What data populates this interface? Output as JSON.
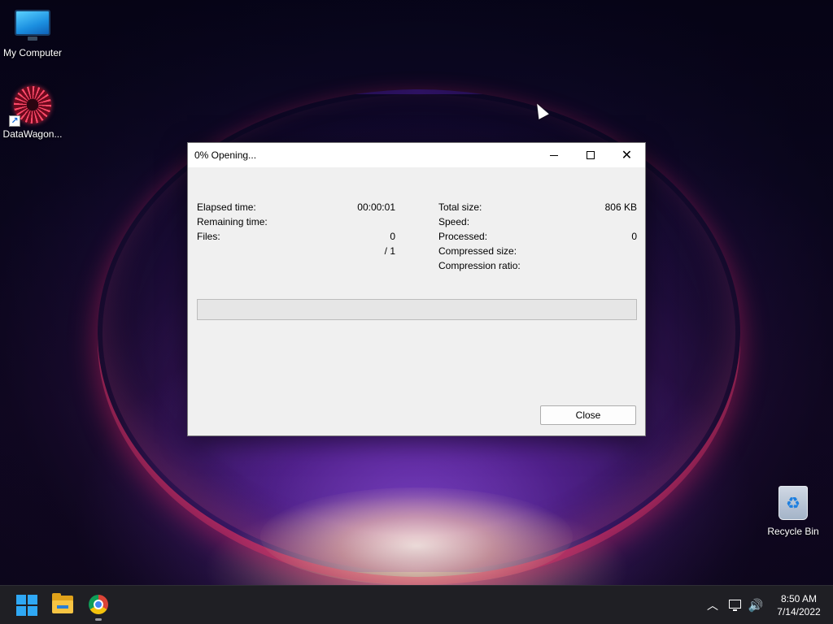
{
  "desktop": {
    "icons": [
      {
        "label": "My Computer"
      },
      {
        "label": "DataWagon..."
      },
      {
        "label": "Recycle Bin"
      }
    ]
  },
  "dialog": {
    "title": "0% Opening...",
    "progress_percent": 0,
    "left_stats": [
      {
        "label": "Elapsed time:",
        "value": "00:00:01"
      },
      {
        "label": "Remaining time:",
        "value": ""
      },
      {
        "label": "Files:",
        "value": "0"
      },
      {
        "label": "",
        "value": "/ 1"
      }
    ],
    "right_stats": [
      {
        "label": "Total size:",
        "value": "806 KB"
      },
      {
        "label": "Speed:",
        "value": ""
      },
      {
        "label": "Processed:",
        "value": "0"
      },
      {
        "label": "Compressed size:",
        "value": ""
      },
      {
        "label": "Compression ratio:",
        "value": ""
      }
    ],
    "close_label": "Close"
  },
  "taskbar": {
    "pinned": [
      "start-icon",
      "file-explorer-icon",
      "chrome-icon"
    ],
    "clock": {
      "time": "8:50 AM",
      "date": "7/14/2022"
    }
  },
  "colors": {
    "taskbar_bg": "#1f1f24",
    "dialog_bg": "#f0f0f0",
    "progress_fill": "#06b025",
    "start_blue": "#2fa8f5"
  }
}
